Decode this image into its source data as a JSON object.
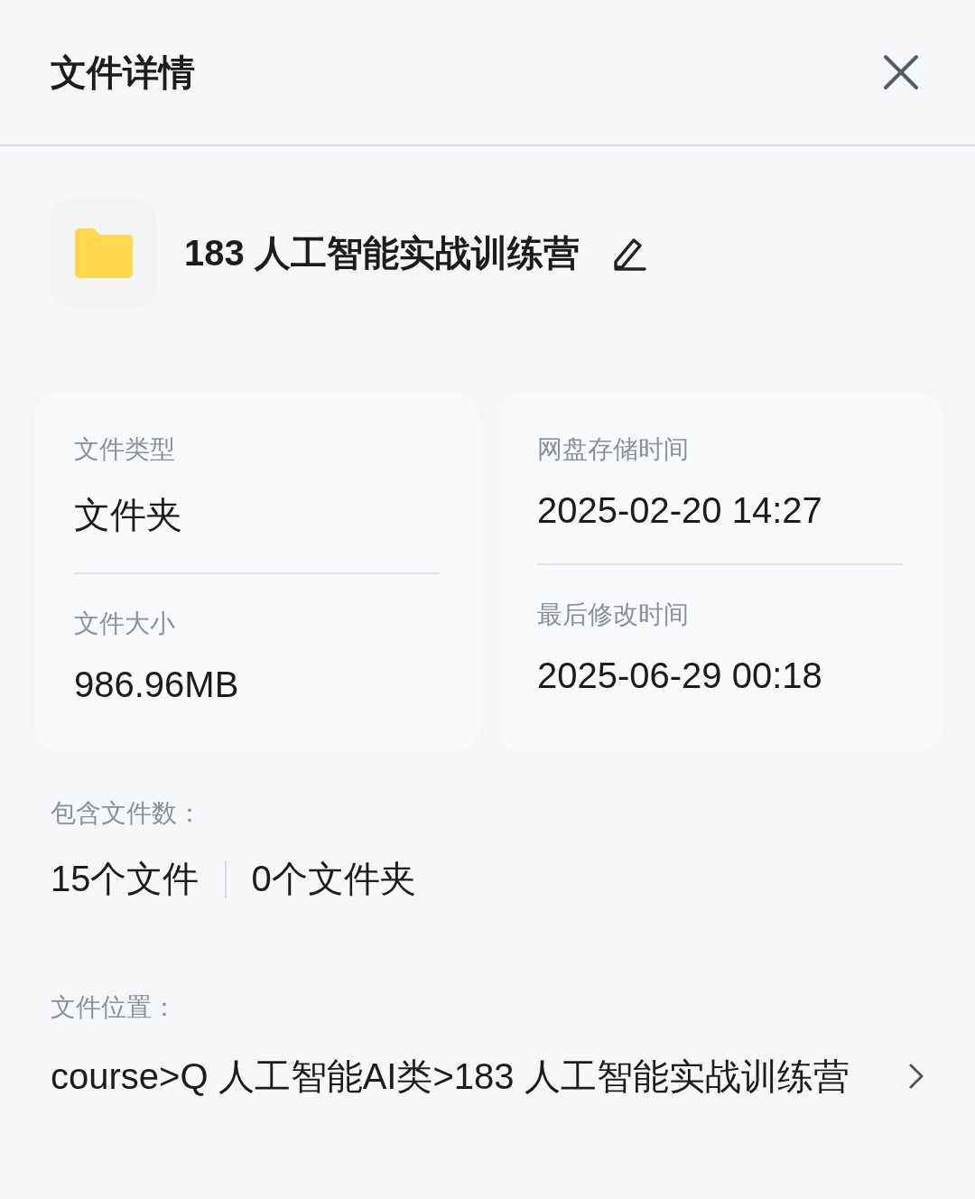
{
  "header": {
    "title": "文件详情"
  },
  "folder": {
    "name": "183 人工智能实战训练营"
  },
  "info_cards": [
    {
      "fields": [
        {
          "label": "文件类型",
          "value": "文件夹"
        },
        {
          "label": "文件大小",
          "value": "986.96MB"
        }
      ]
    },
    {
      "fields": [
        {
          "label": "网盘存储时间",
          "value": "2025-02-20 14:27"
        },
        {
          "label": "最后修改时间",
          "value": "2025-06-29 00:18"
        }
      ]
    }
  ],
  "contents": {
    "label": "包含文件数：",
    "counts": [
      "15个文件",
      "0个文件夹"
    ]
  },
  "location": {
    "label": "文件位置：",
    "path": "course>Q 人工智能AI类>183 人工智能实战训练营"
  }
}
